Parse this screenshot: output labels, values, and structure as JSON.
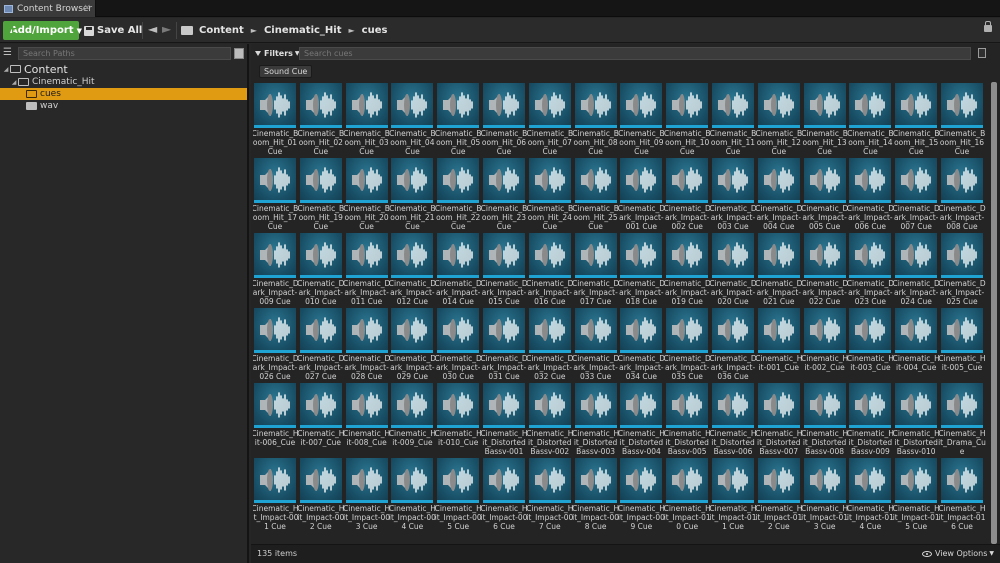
{
  "tab": {
    "title": "Content Browser",
    "close": "×"
  },
  "toolbar": {
    "add_label": "Add/Import",
    "save_label": "Save All",
    "back": "◄",
    "forward": "►",
    "breadcrumb": [
      "Content",
      "Cinematic_Hit",
      "cues"
    ],
    "crumb_sep": "►"
  },
  "sidebar": {
    "search_placeholder": "Search Paths",
    "tree": [
      {
        "label": "Content",
        "depth": 0,
        "expanded": true,
        "selected": false
      },
      {
        "label": "Cinematic_Hit",
        "depth": 1,
        "expanded": true,
        "selected": false
      },
      {
        "label": "cues",
        "depth": 2,
        "expanded": false,
        "selected": true
      },
      {
        "label": "wav",
        "depth": 2,
        "expanded": false,
        "selected": false
      }
    ]
  },
  "content": {
    "filters_label": "Filters",
    "search_placeholder": "Search cues",
    "active_filter": "Sound Cue",
    "item_count": "135 items",
    "view_options": "View Options",
    "assets": [
      "Cinematic_Boom_Hit_01 Cue",
      "Cinematic_Boom_Hit_02 Cue",
      "Cinematic_Boom_Hit_03 Cue",
      "Cinematic_Boom_Hit_04 Cue",
      "Cinematic_Boom_Hit_05 Cue",
      "Cinematic_Boom_Hit_06 Cue",
      "Cinematic_Boom_Hit_07 Cue",
      "Cinematic_Boom_Hit_08 Cue",
      "Cinematic_Boom_Hit_09 Cue",
      "Cinematic_Boom_Hit_10 Cue",
      "Cinematic_Boom_Hit_11 Cue",
      "Cinematic_Boom_Hit_12 Cue",
      "Cinematic_Boom_Hit_13 Cue",
      "Cinematic_Boom_Hit_14 Cue",
      "Cinematic_Boom_Hit_15 Cue",
      "Cinematic_Boom_Hit_16 Cue",
      "Cinematic_Boom_Hit_17 Cue",
      "Cinematic_Boom_Hit_19 Cue",
      "Cinematic_Boom_Hit_20 Cue",
      "Cinematic_Boom_Hit_21 Cue",
      "Cinematic_Boom_Hit_22 Cue",
      "Cinematic_Boom_Hit_23 Cue",
      "Cinematic_Boom_Hit_24 Cue",
      "Cinematic_Boom_Hit_25 Cue",
      "Cinematic_Dark_Impact-001 Cue",
      "Cinematic_Dark_Impact-002 Cue",
      "Cinematic_Dark_Impact-003 Cue",
      "Cinematic_Dark_Impact-004 Cue",
      "Cinematic_Dark_Impact-005 Cue",
      "Cinematic_Dark_Impact-006 Cue",
      "Cinematic_Dark_Impact-007 Cue",
      "Cinematic_Dark_Impact-008 Cue",
      "Cinematic_Dark_Impact-009 Cue",
      "Cinematic_Dark_Impact-010 Cue",
      "Cinematic_Dark_Impact-011 Cue",
      "Cinematic_Dark_Impact-012 Cue",
      "Cinematic_Dark_Impact-014 Cue",
      "Cinematic_Dark_Impact-015 Cue",
      "Cinematic_Dark_Impact-016 Cue",
      "Cinematic_Dark_Impact-017 Cue",
      "Cinematic_Dark_Impact-018 Cue",
      "Cinematic_Dark_Impact-019 Cue",
      "Cinematic_Dark_Impact-020 Cue",
      "Cinematic_Dark_Impact-021 Cue",
      "Cinematic_Dark_Impact-022 Cue",
      "Cinematic_Dark_Impact-023 Cue",
      "Cinematic_Dark_Impact-024 Cue",
      "Cinematic_Dark_Impact-025 Cue",
      "Cinematic_Dark_Impact-026 Cue",
      "Cinematic_Dark_Impact-027 Cue",
      "Cinematic_Dark_Impact-028 Cue",
      "Cinematic_Dark_Impact-029 Cue",
      "Cinematic_Dark_Impact-030 Cue",
      "Cinematic_Dark_Impact-031 Cue",
      "Cinematic_Dark_Impact-032 Cue",
      "Cinematic_Dark_Impact-033 Cue",
      "Cinematic_Dark_Impact-034 Cue",
      "Cinematic_Dark_Impact-035 Cue",
      "Cinematic_Dark_Impact-036 Cue",
      "Cinematic_Hit-001_Cue",
      "Cinematic_Hit-002_Cue",
      "Cinematic_Hit-003_Cue",
      "Cinematic_Hit-004_Cue",
      "Cinematic_Hit-005_Cue",
      "Cinematic_Hit-006_Cue",
      "Cinematic_Hit-007_Cue",
      "Cinematic_Hit-008_Cue",
      "Cinematic_Hit-009_Cue",
      "Cinematic_Hit-010_Cue",
      "Cinematic_Hit_Distorted Bassv-001",
      "Cinematic_Hit_Distorted Bassv-002",
      "Cinematic_Hit_Distorted Bassv-003",
      "Cinematic_Hit_Distorted Bassv-004",
      "Cinematic_Hit_Distorted Bassv-005",
      "Cinematic_Hit_Distorted Bassv-006",
      "Cinematic_Hit_Distorted Bassv-007",
      "Cinematic_Hit_Distorted Bassv-008",
      "Cinematic_Hit_Distorted Bassv-009",
      "Cinematic_Hit_Distorted Bassv-010",
      "Cinematic_Hit_Drama_Cue",
      "Cinematic_Hit_Impact-001 Cue",
      "Cinematic_Hit_Impact-002 Cue",
      "Cinematic_Hit_Impact-003 Cue",
      "Cinematic_Hit_Impact-004 Cue",
      "Cinematic_Hit_Impact-005 Cue",
      "Cinematic_Hit_Impact-006 Cue",
      "Cinematic_Hit_Impact-007 Cue",
      "Cinematic_Hit_Impact-008 Cue",
      "Cinematic_Hit_Impact-009 Cue",
      "Cinematic_Hit_Impact-010 Cue",
      "Cinematic_Hit_Impact-011 Cue",
      "Cinematic_Hit_Impact-012 Cue",
      "Cinematic_Hit_Impact-013 Cue",
      "Cinematic_Hit_Impact-014 Cue",
      "Cinematic_Hit_Impact-015 Cue",
      "Cinematic_Hit_Impact-016 Cue"
    ],
    "thumb_colors": {
      "bg": "#1a5a73",
      "underline": "#1ea3d2",
      "speaker": "#bfbfbf",
      "wave": "#ffffff"
    }
  },
  "colors": {
    "add_button": "#4fa43c",
    "tree_selected": "#e09b12"
  }
}
